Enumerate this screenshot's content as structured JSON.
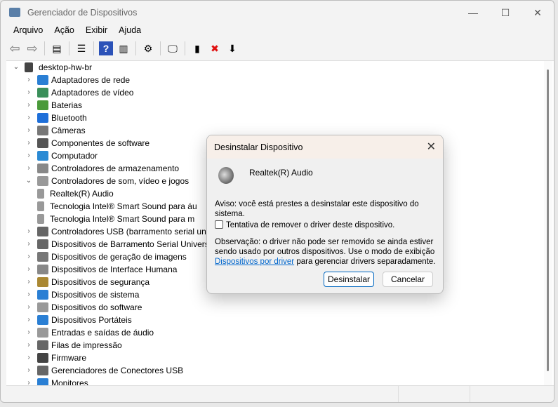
{
  "window": {
    "title": "Gerenciador de Dispositivos",
    "controls": [
      "—",
      "☐",
      "✕"
    ]
  },
  "menu": [
    "Arquivo",
    "Ação",
    "Exibir",
    "Ajuda"
  ],
  "toolbar": [
    {
      "icon": "back-icon",
      "g": "⇦"
    },
    {
      "icon": "forward-icon",
      "g": "⇨"
    },
    {
      "sep": true
    },
    {
      "icon": "show-hide-tree-icon",
      "g": "▤"
    },
    {
      "sep": true
    },
    {
      "icon": "properties-icon",
      "g": "☰"
    },
    {
      "sep": true
    },
    {
      "icon": "help-icon",
      "g": "?"
    },
    {
      "icon": "action-pane-icon",
      "g": "▥"
    },
    {
      "sep": true
    },
    {
      "icon": "update-driver-icon",
      "g": "⚙"
    },
    {
      "sep": true
    },
    {
      "icon": "scan-hardware-icon",
      "g": "🖵"
    },
    {
      "sep": true
    },
    {
      "icon": "enable-device-icon",
      "g": "▮"
    },
    {
      "icon": "uninstall-icon",
      "g": "✖"
    },
    {
      "icon": "download-icon",
      "g": "⬇"
    }
  ],
  "tree": {
    "root": "desktop-hw-br",
    "items": [
      {
        "label": "Adaptadores de rede",
        "level": 1,
        "color": "#2a7fd4"
      },
      {
        "label": "Adaptadores de vídeo",
        "level": 1,
        "color": "#3a8f5a"
      },
      {
        "label": "Baterias",
        "level": 1,
        "color": "#4a9a3a"
      },
      {
        "label": "Bluetooth",
        "level": 1,
        "color": "#1e6fd9"
      },
      {
        "label": "Câmeras",
        "level": 1,
        "color": "#777777"
      },
      {
        "label": "Componentes de software",
        "level": 1,
        "color": "#555555"
      },
      {
        "label": "Computador",
        "level": 1,
        "color": "#2a8ad4"
      },
      {
        "label": "Controladores de armazenamento",
        "level": 1,
        "color": "#888888"
      },
      {
        "label": "Controladores de som, vídeo e jogos",
        "level": 1,
        "expanded": true,
        "color": "#999999"
      },
      {
        "label": "Realtek(R) Audio",
        "level": 2,
        "color": "#999999"
      },
      {
        "label": "Tecnologia Intel® Smart Sound para áu",
        "level": 2,
        "color": "#999999"
      },
      {
        "label": "Tecnologia Intel® Smart Sound para m",
        "level": 2,
        "color": "#999999"
      },
      {
        "label": "Controladores USB (barramento serial univ",
        "level": 1,
        "color": "#666666"
      },
      {
        "label": "Dispositivos de Barramento Serial Universa",
        "level": 1,
        "color": "#666666"
      },
      {
        "label": "Dispositivos de geração de imagens",
        "level": 1,
        "color": "#777777"
      },
      {
        "label": "Dispositivos de Interface Humana",
        "level": 1,
        "color": "#888888"
      },
      {
        "label": "Dispositivos de segurança",
        "level": 1,
        "color": "#aa8833"
      },
      {
        "label": "Dispositivos de sistema",
        "level": 1,
        "color": "#2a7fd4"
      },
      {
        "label": "Dispositivos do software",
        "level": 1,
        "color": "#999999"
      },
      {
        "label": "Dispositivos Portáteis",
        "level": 1,
        "color": "#2a7fd4"
      },
      {
        "label": "Entradas e saídas de áudio",
        "level": 1,
        "color": "#999999"
      },
      {
        "label": "Filas de impressão",
        "level": 1,
        "color": "#666666"
      },
      {
        "label": "Firmware",
        "level": 1,
        "color": "#444444"
      },
      {
        "label": "Gerenciadores de Conectores USB",
        "level": 1,
        "color": "#666666"
      },
      {
        "label": "Monitores",
        "level": 1,
        "color": "#2a7fd4"
      }
    ]
  },
  "dialog": {
    "title": "Desinstalar Dispositivo",
    "device": "Realtek(R) Audio",
    "warning": "Aviso: você está prestes a desinstalar este dispositivo do sistema.",
    "checkbox": "Tentativa de remover o driver deste dispositivo.",
    "checked": false,
    "note": "Observação: o driver não pode ser removido se ainda estiver sendo usado por outros dispositivos. Use o modo de exibição",
    "link": "Dispositivos por driver",
    "note_end": " para gerenciar drivers separadamente.",
    "ok": "Desinstalar",
    "cancel": "Cancelar"
  }
}
